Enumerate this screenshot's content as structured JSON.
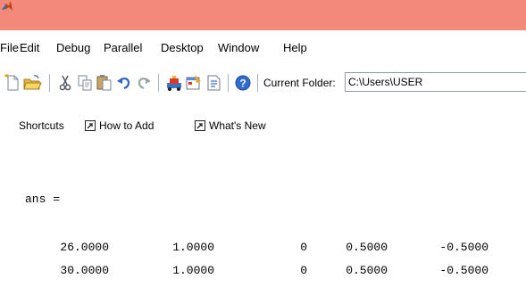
{
  "window": {
    "icon": "matlab-logo-icon",
    "titlebar_color": "#f2897b"
  },
  "menu": {
    "items": [
      "File",
      "Edit",
      "Debug",
      "Parallel",
      "Desktop",
      "Window",
      "Help"
    ]
  },
  "toolbar": {
    "icons": [
      "new-file-icon",
      "open-folder-icon",
      "cut-icon",
      "copy-icon",
      "paste-icon",
      "undo-icon",
      "redo-icon",
      "simulink-icon",
      "guide-icon",
      "profiler-icon",
      "help-icon"
    ],
    "current_folder_label": "Current Folder:",
    "current_folder_value": "C:\\Users\\USER"
  },
  "shortcuts": {
    "label": "Shortcuts",
    "items": [
      {
        "icon": "shortcut-arrow-icon",
        "label": "How to Add"
      },
      {
        "icon": "shortcut-arrow-icon",
        "label": "What's New"
      }
    ]
  },
  "console": {
    "ans_line": "ans =",
    "rows": [
      [
        "26.0000",
        "1.0000",
        "0",
        "0.5000",
        "-0.5000"
      ],
      [
        "30.0000",
        "1.0000",
        "0",
        "0.5000",
        "-0.5000"
      ]
    ]
  }
}
